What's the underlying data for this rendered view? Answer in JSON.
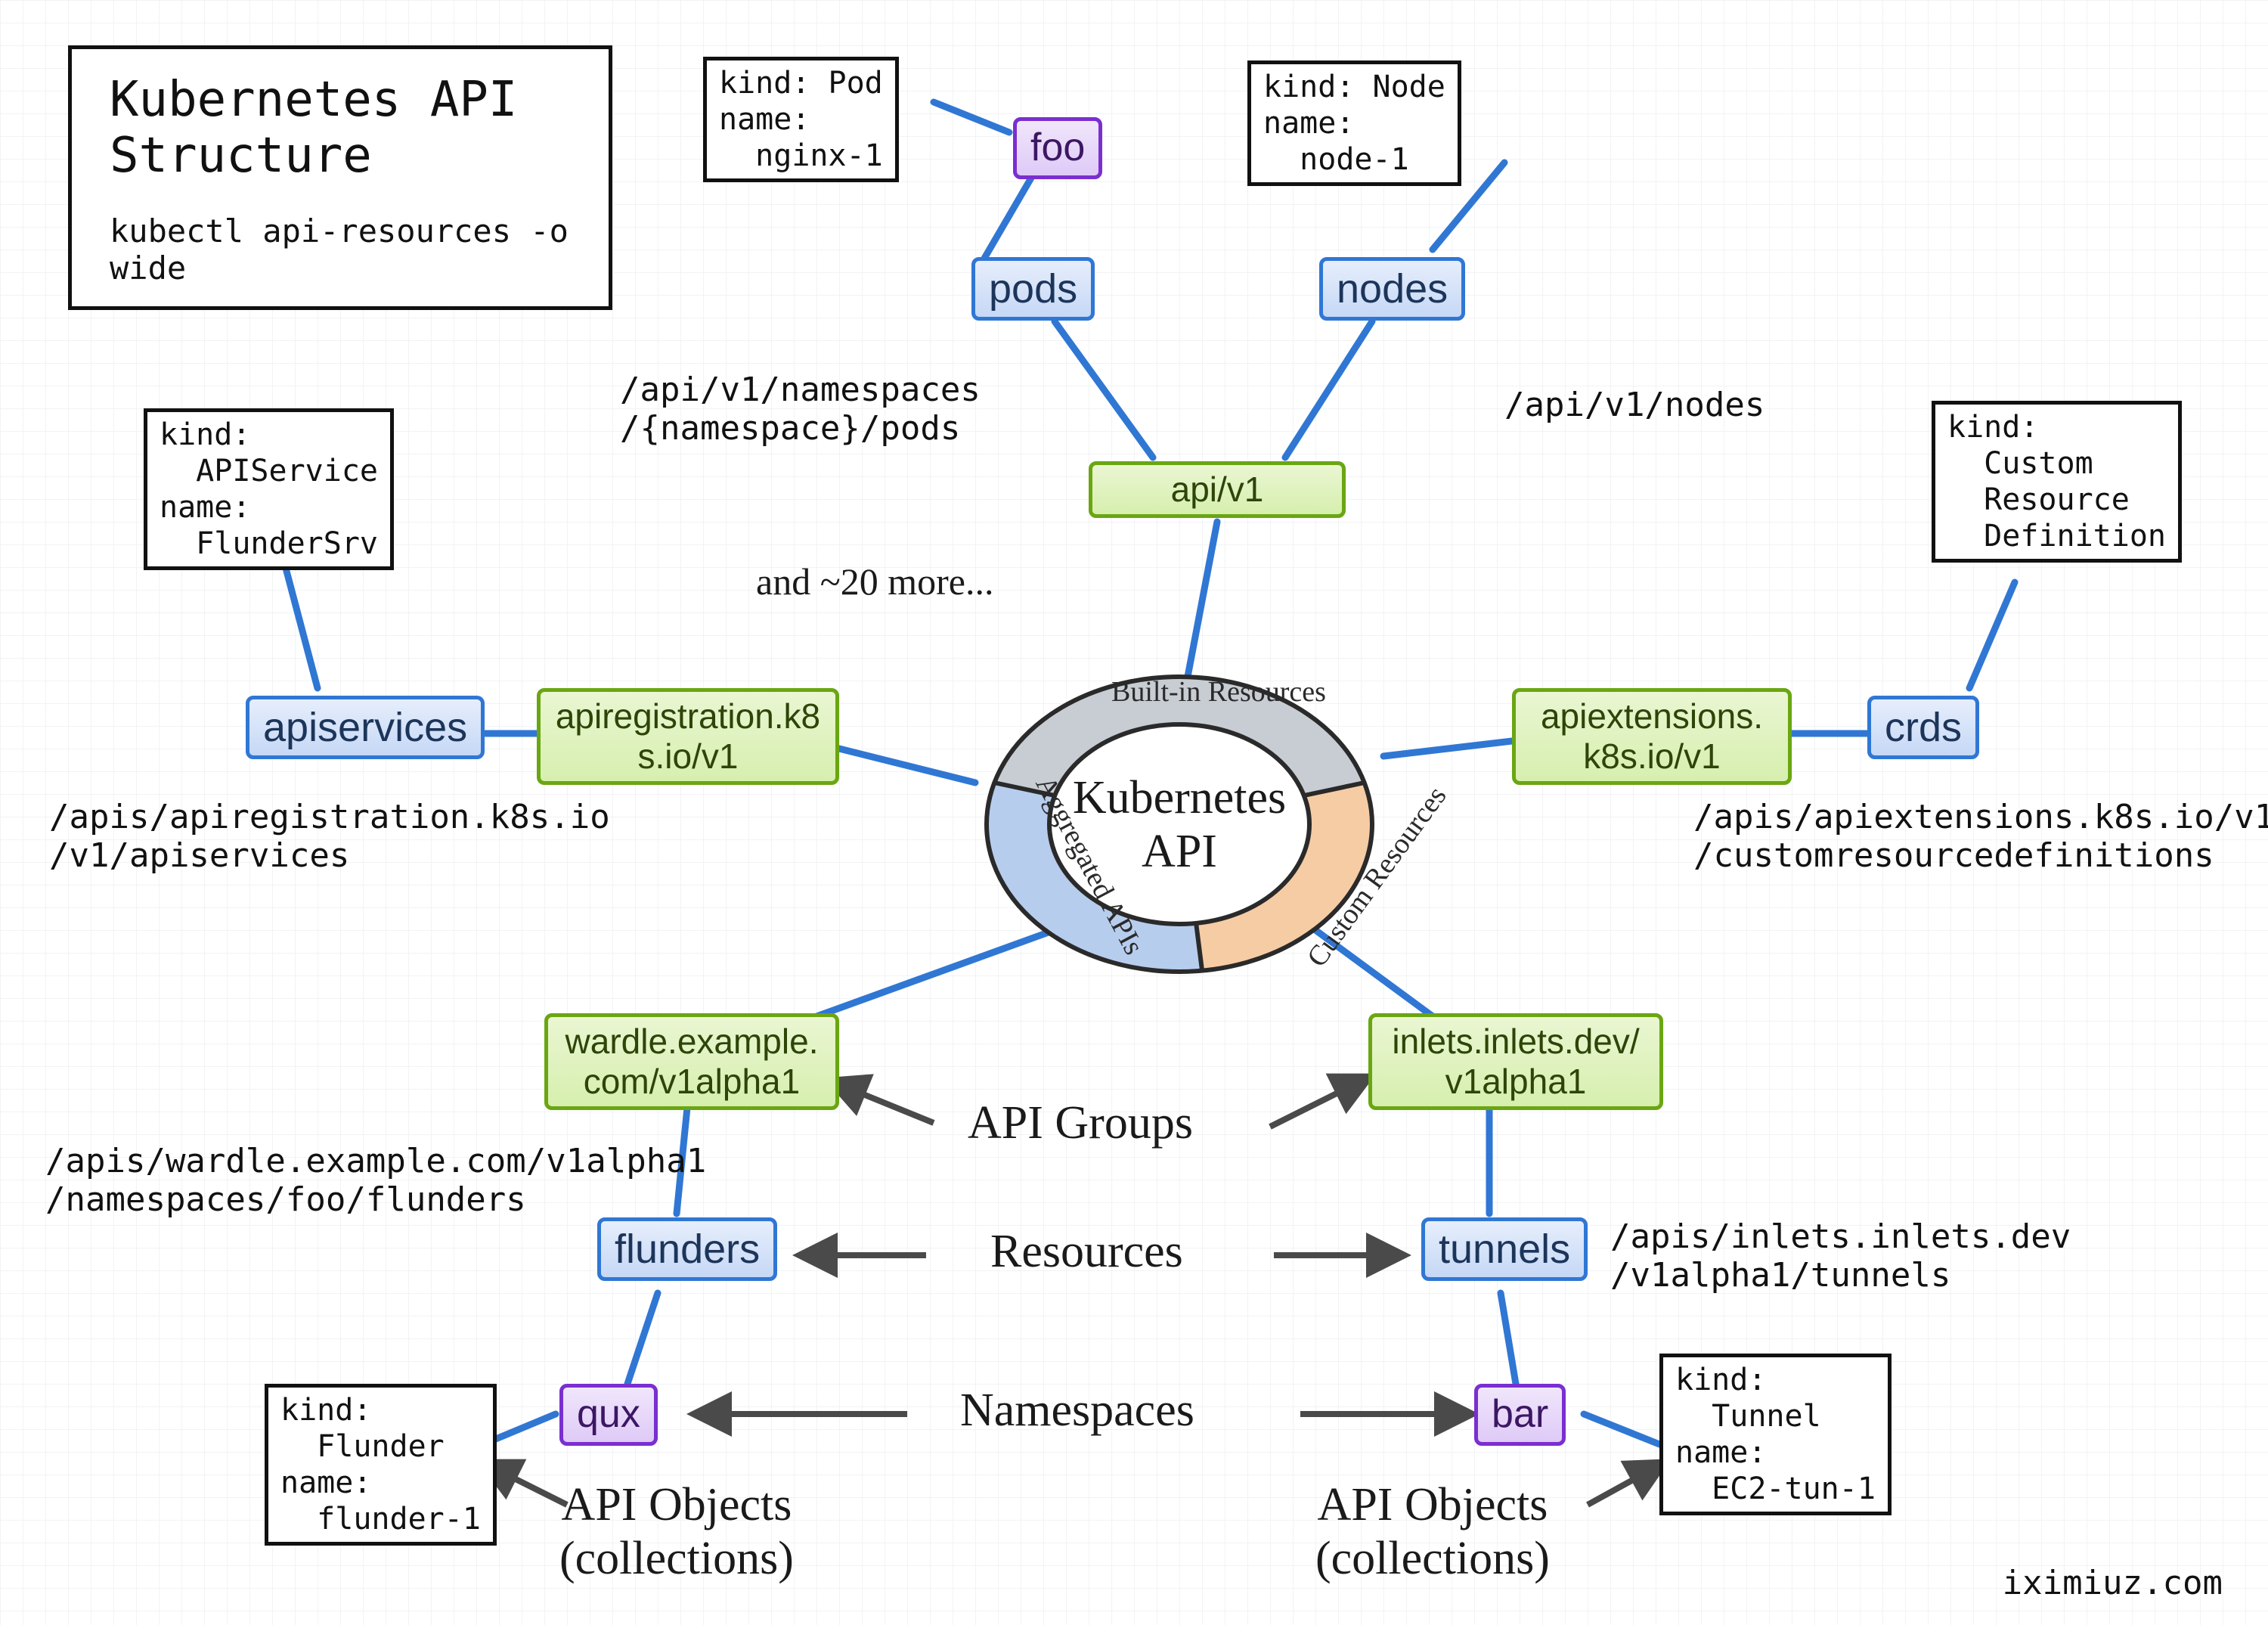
{
  "title": {
    "heading": "Kubernetes API\nStructure",
    "cmd": "kubectl api-resources -o wide"
  },
  "center": {
    "label": "Kubernetes\nAPI",
    "sectors": {
      "builtin": "Built-in\nResources",
      "aggregated": "Aggregated\nAPIs",
      "custom": "Custom\nResources"
    }
  },
  "groups": {
    "core": "api/v1",
    "apireg": "apiregistration.k8\ns.io/v1",
    "apiext": "apiextensions.\nk8s.io/v1",
    "wardle": "wardle.example.\ncom/v1alpha1",
    "inlets": "inlets.inlets.dev/\nv1alpha1"
  },
  "resources": {
    "pods": "pods",
    "nodes": "nodes",
    "apiservices": "apiservices",
    "crds": "crds",
    "flunders": "flunders",
    "tunnels": "tunnels"
  },
  "namespaces": {
    "foo": "foo",
    "qux": "qux",
    "bar": "bar"
  },
  "objects": {
    "pod": "kind: Pod\nname:\n  nginx-1",
    "node": "kind: Node\nname:\n  node-1",
    "apiservice": "kind:\n  APIService\nname:\n  FlunderSrv",
    "crd": "kind:\n  Custom\n  Resource\n  Definition",
    "flunder": "kind:\n  Flunder\nname:\n  flunder-1",
    "tunnel": "kind:\n  Tunnel\nname:\n  EC2-tun-1"
  },
  "paths": {
    "pods": "/api/v1/namespaces\n/{namespace}/pods",
    "nodes": "/api/v1/nodes",
    "apiservices": "/apis/apiregistration.k8s.io\n/v1/apiservices",
    "crds": "/apis/apiextensions.k8s.io/v1\n/customresourcedefinitions",
    "wardle": "/apis/wardle.example.com/v1alpha1\n/namespaces/foo/flunders",
    "inlets": "/apis/inlets.inlets.dev\n/v1alpha1/tunnels"
  },
  "annotations": {
    "more": "and ~20 more...",
    "api_groups": "API Groups",
    "resources": "Resources",
    "namespaces": "Namespaces",
    "api_objects_l": "API Objects\n(collections)",
    "api_objects_r": "API Objects\n(collections)"
  },
  "credit": "iximiuz.com"
}
